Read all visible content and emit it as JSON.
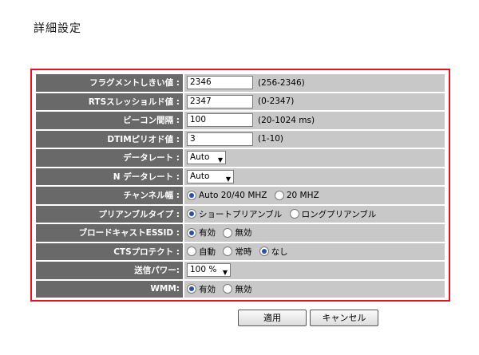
{
  "page": {
    "title": "詳細設定"
  },
  "rows": {
    "fragment": {
      "label": "フラグメントしきい値 :",
      "value": "2346",
      "hint": "(256-2346)"
    },
    "rts": {
      "label": "RTSスレッショルド値 :",
      "value": "2347",
      "hint": "(0-2347)"
    },
    "beacon": {
      "label": "ビーコン間隔 :",
      "value": "100",
      "hint": "(20-1024 ms)"
    },
    "dtim": {
      "label": "DTIMピリオド値 :",
      "value": "3",
      "hint": "(1-10)"
    },
    "datarate": {
      "label": "データレート :",
      "selected": "Auto"
    },
    "ndatarate": {
      "label": "N データレート :",
      "selected": "Auto"
    },
    "channel_width": {
      "label": "チャンネル幅 :",
      "opt1": "Auto 20/40 MHZ",
      "opt2": "20 MHZ",
      "selected": "Auto 20/40 MHZ"
    },
    "preamble": {
      "label": "プリアンブルタイプ :",
      "opt1": "ショートプリアンブル",
      "opt2": "ロングプリアンブル",
      "selected": "ショートプリアンブル"
    },
    "broadcast_essid": {
      "label": "ブロードキャストESSID :",
      "opt1": "有効",
      "opt2": "無効",
      "selected": "有効"
    },
    "cts": {
      "label": "CTSプロテクト :",
      "opt1": "自動",
      "opt2": "常時",
      "opt3": "なし",
      "selected": "なし"
    },
    "tx_power": {
      "label": "送信パワー:",
      "selected": "100 %"
    },
    "wmm": {
      "label": "WMM:",
      "opt1": "有効",
      "opt2": "無効",
      "selected": "有効"
    }
  },
  "buttons": {
    "apply": "適用",
    "cancel": "キャンセル"
  },
  "colors": {
    "frame_border": "#e3141e",
    "label_bg": "#696969",
    "value_bg": "#c8c8c8"
  }
}
